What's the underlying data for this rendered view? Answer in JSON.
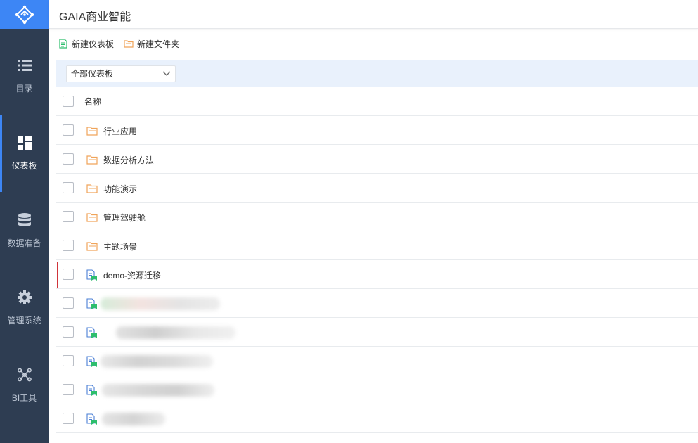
{
  "app": {
    "title": "GAIA商业智能"
  },
  "sidebar": {
    "items": [
      {
        "label": "目录",
        "icon": "list-icon",
        "active": false
      },
      {
        "label": "仪表板",
        "icon": "dashboard-icon",
        "active": true
      },
      {
        "label": "数据准备",
        "icon": "database-icon",
        "active": false
      },
      {
        "label": "管理系统",
        "icon": "gear-icon",
        "active": false
      },
      {
        "label": "BI工具",
        "icon": "network-icon",
        "active": false
      }
    ]
  },
  "toolbar": {
    "new_dashboard": "新建仪表板",
    "new_folder": "新建文件夹"
  },
  "filter": {
    "selected": "全部仪表板"
  },
  "table": {
    "header": "名称",
    "rows": [
      {
        "type": "folder",
        "name": "行业应用"
      },
      {
        "type": "folder",
        "name": "数据分析方法"
      },
      {
        "type": "folder",
        "name": "功能演示"
      },
      {
        "type": "folder",
        "name": "管理驾驶舱"
      },
      {
        "type": "folder",
        "name": "主题场景"
      },
      {
        "type": "dashboard",
        "name": "demo-资源迁移",
        "highlighted": true
      },
      {
        "type": "dashboard",
        "name": ""
      },
      {
        "type": "dashboard",
        "name": ""
      },
      {
        "type": "dashboard",
        "name": ""
      },
      {
        "type": "dashboard",
        "name": ""
      },
      {
        "type": "dashboard",
        "name": ""
      }
    ]
  },
  "colors": {
    "sidebar": "#2e3d52",
    "accent": "#3d86f5",
    "folder": "#f0a45a",
    "dashboard_badge": "#2dbe6c",
    "highlight": "#d0343a"
  }
}
